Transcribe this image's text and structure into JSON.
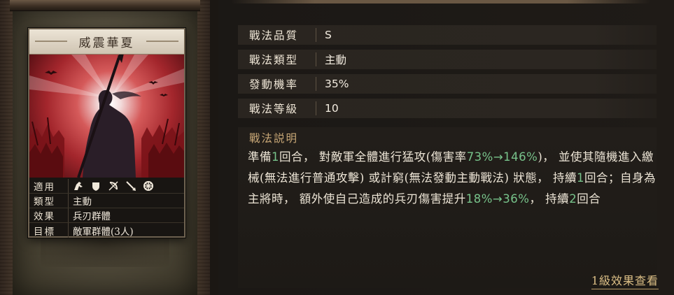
{
  "card": {
    "title": "威震華夏",
    "rows": [
      {
        "key": "適用",
        "value": ""
      },
      {
        "key": "類型",
        "value": "主動"
      },
      {
        "key": "效果",
        "value": "兵刃群體"
      },
      {
        "key": "目標",
        "value": "敵軍群體(3人)"
      }
    ],
    "unit_icons": [
      "cavalry-icon",
      "shield-icon",
      "bow-icon",
      "spear-icon",
      "siege-icon"
    ]
  },
  "stats": [
    {
      "label": "戰法品質",
      "value": "S"
    },
    {
      "label": "戰法類型",
      "value": "主動"
    },
    {
      "label": "發動機率",
      "value": "35%"
    },
    {
      "label": "戰法等級",
      "value": "10"
    }
  ],
  "description": {
    "title": "戰法説明",
    "segments": [
      {
        "t": "準備",
        "c": ""
      },
      {
        "t": "1",
        "c": "g"
      },
      {
        "t": "回合，  對敵軍全體進行猛攻(傷害率",
        "c": ""
      },
      {
        "t": "73%→146%",
        "c": "g"
      },
      {
        "t": ")，  並使其隨機進入繳械(無法進行普通攻擊)  或計窮(無法發動主動戰法)  狀態，  持續",
        "c": ""
      },
      {
        "t": "1",
        "c": "g"
      },
      {
        "t": "回合；自身為主將時，  額外使自己造成的兵刃傷害提升",
        "c": ""
      },
      {
        "t": "18%→36%",
        "c": "g"
      },
      {
        "t": "，  持續",
        "c": ""
      },
      {
        "t": "2",
        "c": "g"
      },
      {
        "t": "回合",
        "c": ""
      }
    ]
  },
  "level_link": "1級效果查看",
  "colors": {
    "highlight": "#77c28a",
    "link": "#dcbf86",
    "section_title": "#c9a877"
  }
}
